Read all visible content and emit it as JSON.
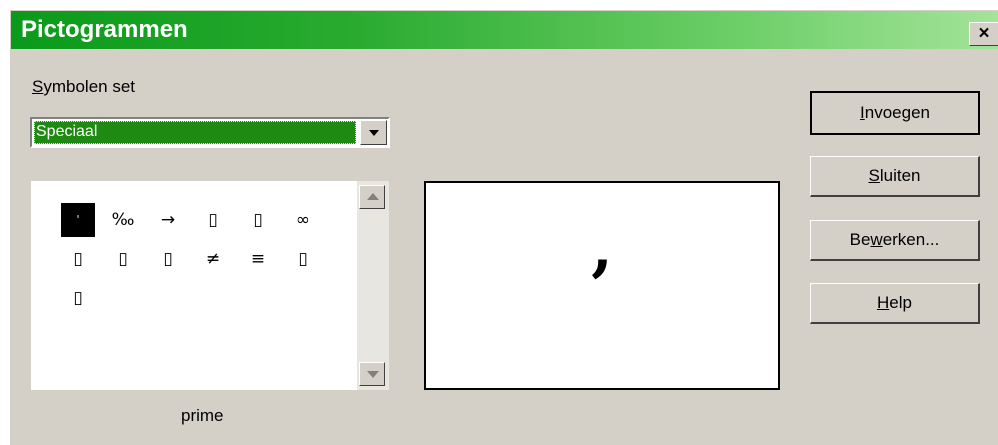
{
  "window": {
    "title": "Pictogrammen",
    "close_label": "×"
  },
  "symbol_set": {
    "label_accel": "S",
    "label_rest": "ymbolen set",
    "selected": "Speciaal"
  },
  "characters": [
    "'",
    "‰",
    "→",
    "▯",
    "▯",
    "∞",
    "▯",
    "▯",
    "▯",
    "≠",
    "≡",
    "▯",
    "▯"
  ],
  "selected_index": 0,
  "selected_name": "prime",
  "preview_glyph": ",",
  "buttons": {
    "insert": {
      "accel": "I",
      "rest": "nvoegen"
    },
    "close": {
      "accel": "S",
      "rest": "luiten"
    },
    "edit": {
      "pre": "Be",
      "accel": "w",
      "rest": "erken..."
    },
    "help": {
      "accel": "H",
      "rest": "elp"
    }
  },
  "colors": {
    "title_gradient_start": "#0a9a1a",
    "title_gradient_end": "#a4e39a",
    "selection": "#1e8a12",
    "dialog_face": "#d4d0c8"
  }
}
